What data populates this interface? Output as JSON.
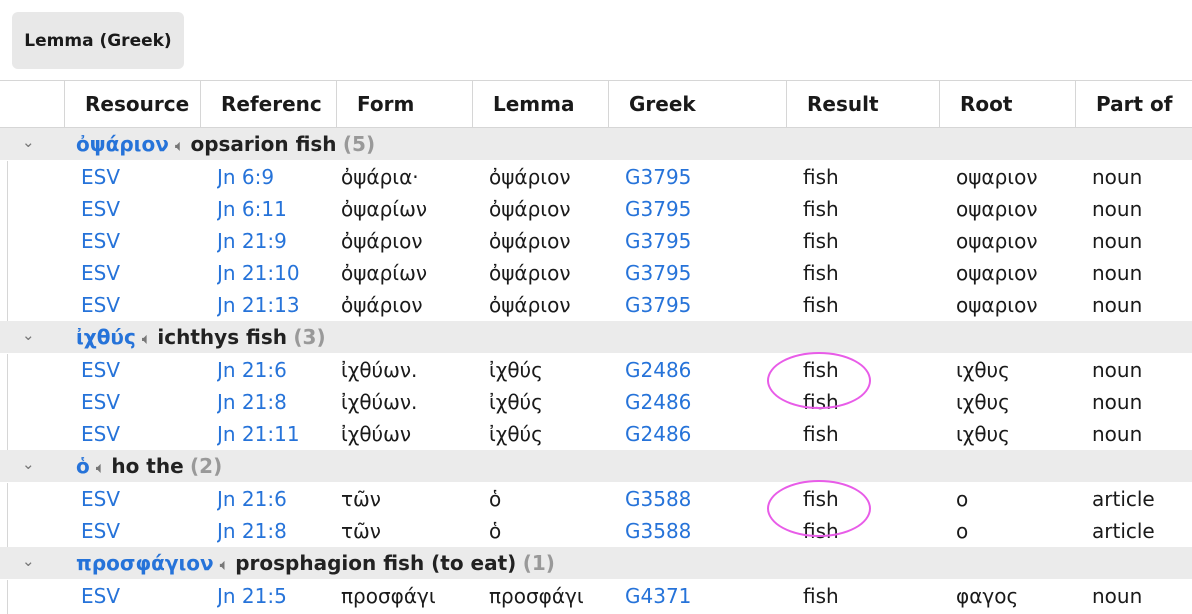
{
  "toolbar": {
    "group_label": "Lemma (Greek)"
  },
  "columns": [
    "Resource",
    "Referenc",
    "Form",
    "Lemma",
    "Greek",
    "Result",
    "Root",
    "Part of"
  ],
  "groups": [
    {
      "lemma": "ὀψάριον",
      "desc": "opsarion fish",
      "count": "(5)",
      "rows": [
        {
          "resource": "ESV",
          "reference": "Jn 6:9",
          "form": "ὀψάρια·",
          "lemma": "ὀψάριον",
          "greek": "G3795",
          "result": "fish",
          "root": "οψαριον",
          "pos": "noun"
        },
        {
          "resource": "ESV",
          "reference": "Jn 6:11",
          "form": "ὀψαρίων",
          "lemma": "ὀψάριον",
          "greek": "G3795",
          "result": "fish",
          "root": "οψαριον",
          "pos": "noun"
        },
        {
          "resource": "ESV",
          "reference": "Jn 21:9",
          "form": "ὀψάριον",
          "lemma": "ὀψάριον",
          "greek": "G3795",
          "result": "fish",
          "root": "οψαριον",
          "pos": "noun"
        },
        {
          "resource": "ESV",
          "reference": "Jn 21:10",
          "form": "ὀψαρίων",
          "lemma": "ὀψάριον",
          "greek": "G3795",
          "result": "fish",
          "root": "οψαριον",
          "pos": "noun"
        },
        {
          "resource": "ESV",
          "reference": "Jn 21:13",
          "form": "ὀψάριον",
          "lemma": "ὀψάριον",
          "greek": "G3795",
          "result": "fish",
          "root": "οψαριον",
          "pos": "noun"
        }
      ]
    },
    {
      "lemma": "ἰχθύς",
      "desc": "ichthys fish",
      "count": "(3)",
      "rows": [
        {
          "resource": "ESV",
          "reference": "Jn 21:6",
          "form": "ἰχθύων.",
          "lemma": "ἰχθύς",
          "greek": "G2486",
          "result": "fish",
          "root": "ιχθυς",
          "pos": "noun"
        },
        {
          "resource": "ESV",
          "reference": "Jn 21:8",
          "form": "ἰχθύων.",
          "lemma": "ἰχθύς",
          "greek": "G2486",
          "result": "fish",
          "root": "ιχθυς",
          "pos": "noun"
        },
        {
          "resource": "ESV",
          "reference": "Jn 21:11",
          "form": "ἰχθύων",
          "lemma": "ἰχθύς",
          "greek": "G2486",
          "result": "fish",
          "root": "ιχθυς",
          "pos": "noun"
        }
      ]
    },
    {
      "lemma": "ὁ",
      "desc": "ho the",
      "count": "(2)",
      "rows": [
        {
          "resource": "ESV",
          "reference": "Jn 21:6",
          "form": "τῶν",
          "lemma": "ὁ",
          "greek": "G3588",
          "result": "fish",
          "root": "ο",
          "pos": "article"
        },
        {
          "resource": "ESV",
          "reference": "Jn 21:8",
          "form": "τῶν",
          "lemma": "ὁ",
          "greek": "G3588",
          "result": "fish",
          "root": "ο",
          "pos": "article"
        }
      ]
    },
    {
      "lemma": "προσφάγιον",
      "desc": "prosphagion fish (to eat)",
      "count": "(1)",
      "rows": [
        {
          "resource": "ESV",
          "reference": "Jn 21:5",
          "form": "προσφάγι",
          "lemma": "προσφάγι",
          "greek": "G4371",
          "result": "fish",
          "root": "φαγος",
          "pos": "noun"
        }
      ]
    }
  ],
  "colors": {
    "link": "#2673d9",
    "highlight": "#e85ce8",
    "group_bg": "#ebebeb"
  }
}
